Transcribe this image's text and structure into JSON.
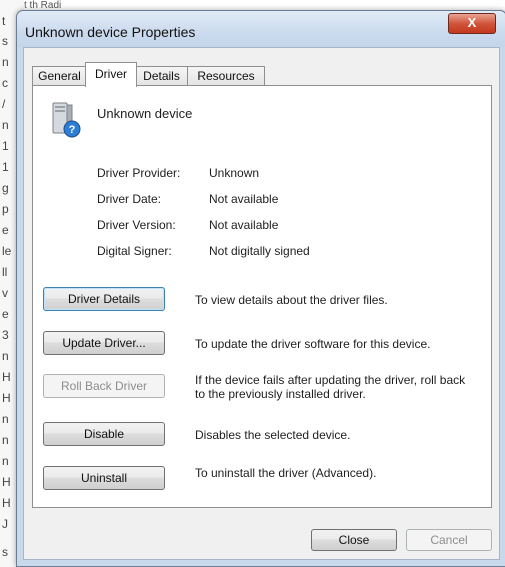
{
  "background": {
    "top_text": "t th Radi",
    "edge_chars": [
      "t",
      "s",
      "n",
      "c",
      "/",
      "n",
      "1",
      "1",
      "g",
      "p",
      "e",
      "le",
      "ll",
      "v",
      "e",
      "3",
      "n",
      "H",
      "H",
      "n",
      "n",
      "n",
      "H",
      "H",
      "J",
      "s"
    ]
  },
  "window": {
    "title": "Unknown device Properties",
    "close_label": "X"
  },
  "tabs": [
    {
      "label": "General"
    },
    {
      "label": "Driver"
    },
    {
      "label": "Details"
    },
    {
      "label": "Resources"
    }
  ],
  "device": {
    "name": "Unknown device",
    "icon": "unknown-device-icon"
  },
  "properties": [
    {
      "label": "Driver Provider:",
      "value": "Unknown"
    },
    {
      "label": "Driver Date:",
      "value": "Not available"
    },
    {
      "label": "Driver Version:",
      "value": "Not available"
    },
    {
      "label": "Digital Signer:",
      "value": "Not digitally signed"
    }
  ],
  "actions": [
    {
      "button": "Driver Details",
      "description": "To view details about the driver files."
    },
    {
      "button": "Update Driver...",
      "description": "To update the driver software for this device."
    },
    {
      "button": "Roll Back Driver",
      "description": "If the device fails after updating the driver, roll back to the previously installed driver."
    },
    {
      "button": "Disable",
      "description": "Disables the selected device."
    },
    {
      "button": "Uninstall",
      "description": "To uninstall the driver (Advanced)."
    }
  ],
  "footer": {
    "close_label": "Close",
    "cancel_label": "Cancel"
  },
  "colors": {
    "close_button": "#c2381d",
    "window_frame": "#c9d9ec"
  }
}
